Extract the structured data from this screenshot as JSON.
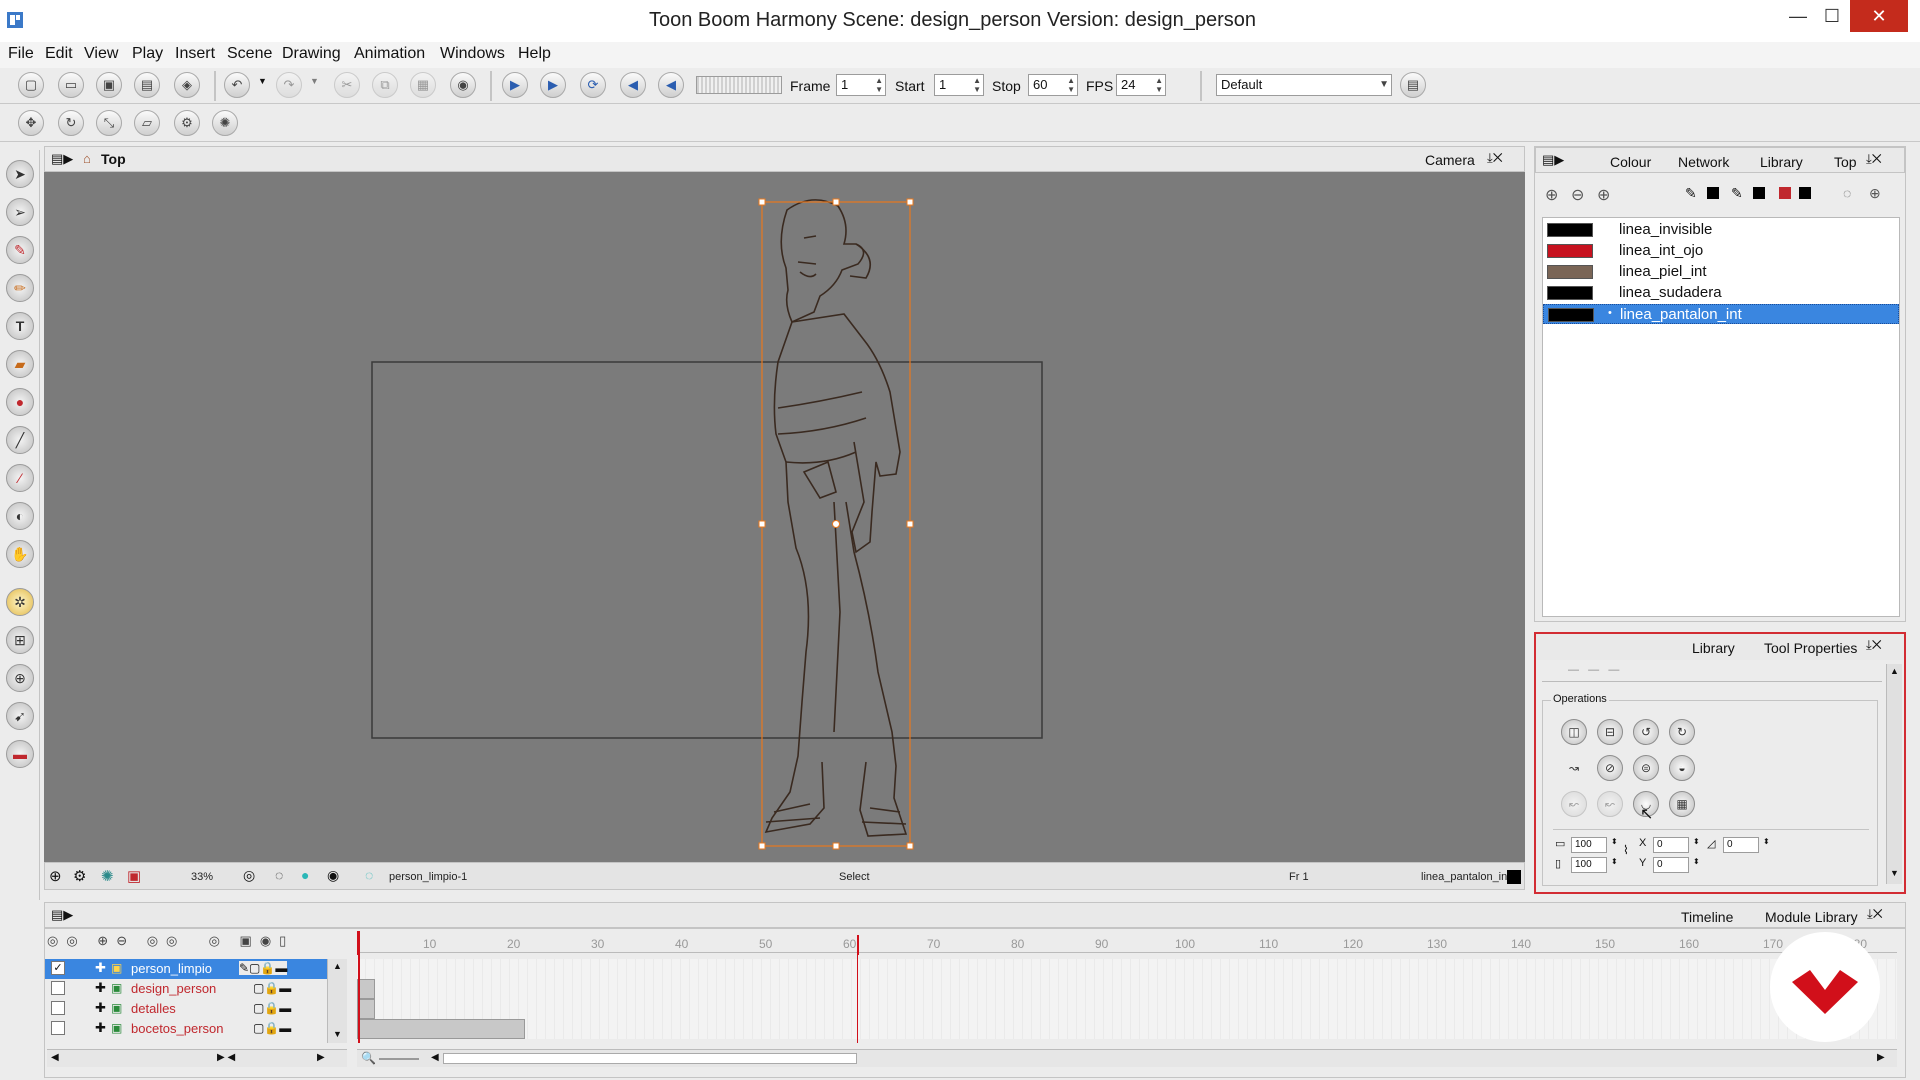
{
  "window": {
    "title": "Toon Boom Harmony Scene: design_person Version: design_person",
    "minimize": "—",
    "maximize": "☐",
    "close": "✕"
  },
  "menu": [
    "File",
    "Edit",
    "View",
    "Play",
    "Insert",
    "Scene",
    "Drawing",
    "Animation",
    "Windows",
    "Help"
  ],
  "toolbar": {
    "frame_label": "Frame",
    "frame_value": "1",
    "start_label": "Start",
    "start_value": "1",
    "stop_label": "Stop",
    "stop_value": "60",
    "fps_label": "FPS",
    "fps_value": "24",
    "workspace_value": "Default"
  },
  "viewer": {
    "title": "Top",
    "camera_tab": "Camera",
    "zoom": "33%",
    "drawing_name": "person_limpio-1",
    "tool_status": "Select",
    "frame_status": "Fr 1",
    "colour_status": "linea_pantalon_int"
  },
  "colour_panel": {
    "tabs": [
      "Colour",
      "Network",
      "Library",
      "Top"
    ],
    "swatches": [
      {
        "name": "linea_invisible",
        "color": "#000000"
      },
      {
        "name": "linea_int_ojo",
        "color": "#c7121f"
      },
      {
        "name": "linea_piel_int",
        "color": "#7a6556"
      },
      {
        "name": "linea_sudadera",
        "color": "#000000"
      },
      {
        "name": "linea_pantalon_int",
        "color": "#000000"
      }
    ],
    "selected_index": 4,
    "selection_color": "#3a86e0"
  },
  "tool_panel": {
    "tabs": [
      "Library",
      "Tool Properties"
    ],
    "operations_label": "Operations",
    "width_value": "100",
    "height_value": "100",
    "x_value": "0",
    "y_value": "0",
    "angle_value": "0"
  },
  "timeline": {
    "tabs": [
      "Timeline",
      "Module Library"
    ],
    "ruler": [
      "10",
      "20",
      "30",
      "40",
      "50",
      "60",
      "70",
      "80",
      "90",
      "100",
      "110",
      "120",
      "130",
      "140",
      "150",
      "160",
      "170",
      "180"
    ],
    "layers": [
      {
        "name": "person_limpio",
        "checked": true,
        "selected": true
      },
      {
        "name": "design_person",
        "checked": false,
        "selected": false
      },
      {
        "name": "detalles",
        "checked": false,
        "selected": false
      },
      {
        "name": "bocetos_person",
        "checked": false,
        "selected": false
      }
    ],
    "current_frame": 1,
    "stop_frame": 60
  },
  "colors": {
    "accent_red": "#d22c33",
    "outline_orange": "#e9781d"
  }
}
